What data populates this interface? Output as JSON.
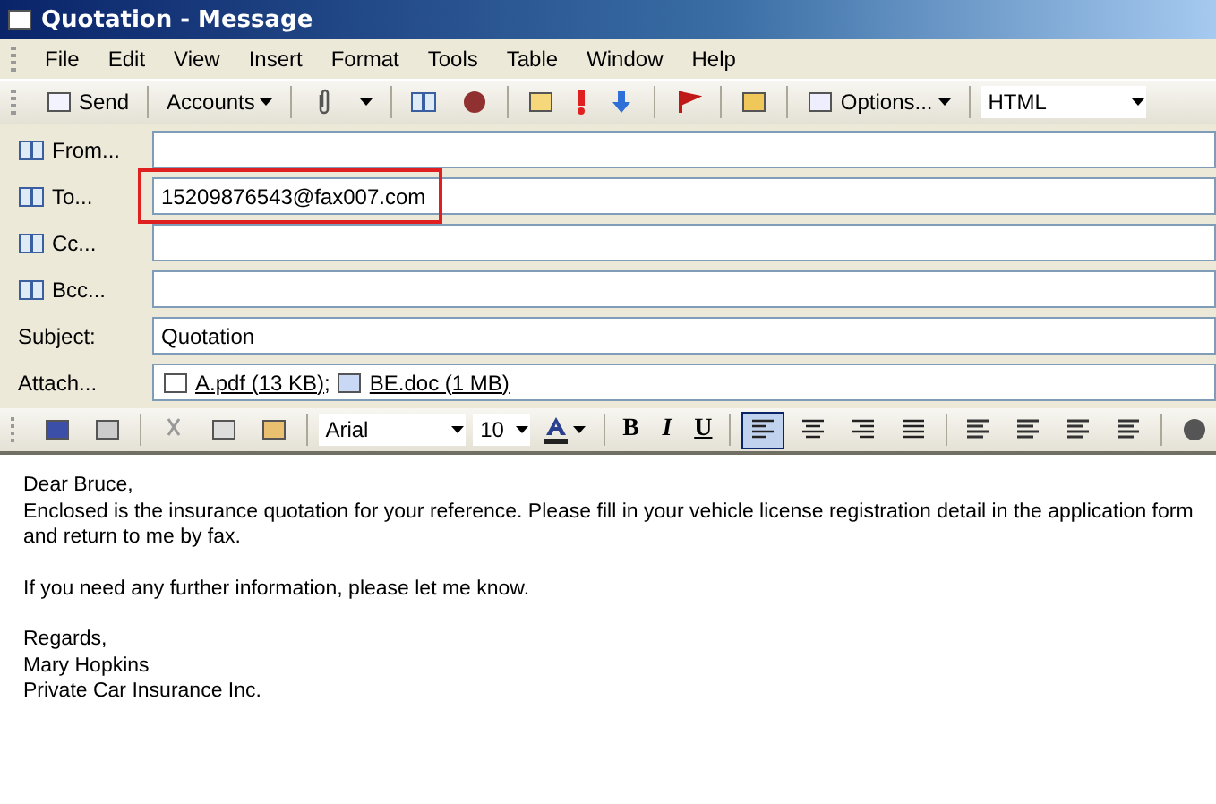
{
  "window": {
    "title": "Quotation - Message"
  },
  "menu": [
    "File",
    "Edit",
    "View",
    "Insert",
    "Format",
    "Tools",
    "Table",
    "Window",
    "Help"
  ],
  "toolbar": {
    "send": "Send",
    "accounts": "Accounts",
    "options": "Options...",
    "format": "HTML"
  },
  "fields": [
    {
      "kind": "address",
      "label": "From...",
      "highlighted": false
    },
    {
      "kind": "address",
      "label": "To...",
      "value": "15209876543@fax007.com",
      "highlighted": true
    },
    {
      "kind": "address",
      "label": "Cc...",
      "highlighted": false
    },
    {
      "kind": "address",
      "label": "Bcc...",
      "highlighted": false
    },
    {
      "kind": "plain",
      "label": "Subject:",
      "value": "Quotation",
      "highlighted": false
    }
  ],
  "attach": {
    "label": "Attach...",
    "files": [
      {
        "kind": "pdf",
        "name": "A.pdf (13 KB)",
        "separator": ";"
      },
      {
        "kind": "doc",
        "name": "BE.doc (1 MB)"
      }
    ]
  },
  "formatting": {
    "font": "Arial",
    "size": "10",
    "styles": [
      "B",
      "I",
      "U"
    ],
    "alignments": [
      {
        "kind": "left",
        "selected": true
      },
      {
        "kind": "center",
        "selected": false
      },
      {
        "kind": "right",
        "selected": false
      },
      {
        "kind": "justify",
        "selected": false
      }
    ]
  },
  "body": [
    [
      "Dear Bruce,",
      "Enclosed is the insurance quotation for your reference.  Please fill in your vehicle license registration detail in the application form",
      "and return to me by fax."
    ],
    [
      "If you need any further information, please let me know."
    ],
    [
      "Regards,",
      "Mary Hopkins",
      "Private Car Insurance Inc."
    ]
  ]
}
